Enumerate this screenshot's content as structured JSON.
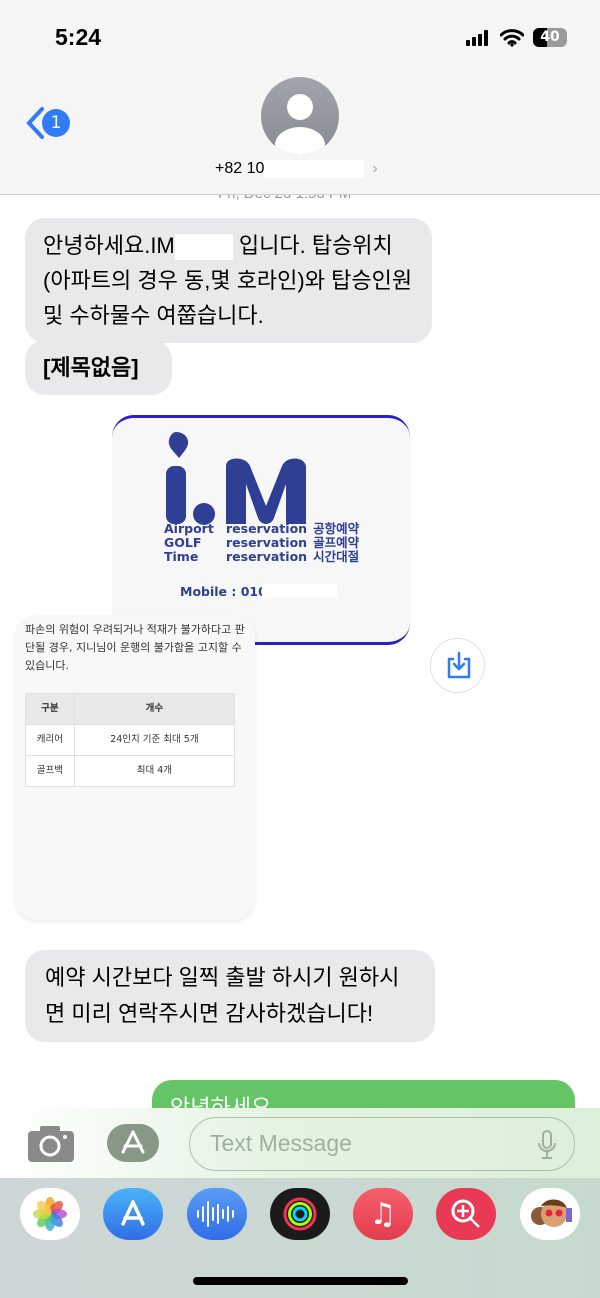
{
  "status_bar": {
    "time": "5:24",
    "battery": "40"
  },
  "header": {
    "back_badge": "1",
    "contact": "+82 10"
  },
  "timestamp": "Fri, Dec 23 1:53 PM",
  "messages": [
    {
      "type": "received",
      "text_before": "안녕하세요.IM",
      "text_after": " 입니다. 탑승위치(아파트의 경우 동,몇 호라인)와 탑승인원 및 수하물수 여쭙습니다."
    },
    {
      "type": "received",
      "text": "[제목없음]"
    },
    {
      "type": "received",
      "text": "예약 시간보다 일찍 출발 하시기 원하시면 미리 연락주시면 감사하겠습니다!"
    },
    {
      "type": "sent",
      "text": "안녕하세요"
    }
  ],
  "card1": {
    "logo": "i.M",
    "rows": [
      [
        "Airport",
        "reservation",
        "공항예약"
      ],
      [
        "GOLF",
        "reservation",
        "골프예약"
      ],
      [
        "Time",
        "reservation",
        "시간대절"
      ]
    ],
    "mobile": "Mobile : 010."
  },
  "card2": {
    "text": "파손의 위험이 우려되거나 적재가 불가하다고 판단될 경우, 지니님이 운행의 불가함을 고지할 수 있습니다.",
    "headers": [
      "구분",
      "개수"
    ],
    "rows": [
      [
        "캐리어",
        "24인치 기준 최대 5개"
      ],
      [
        "골프백",
        "최대 4개"
      ]
    ]
  },
  "input": {
    "placeholder": "Text Message"
  },
  "dock": [
    "photos",
    "app-store",
    "audio-message",
    "activity",
    "music",
    "image-search",
    "memoji"
  ],
  "colors": {
    "accent": "#2f7cf6",
    "sent": "#65c466",
    "received": "#e9e9eb",
    "logo": "#2e3f94"
  }
}
